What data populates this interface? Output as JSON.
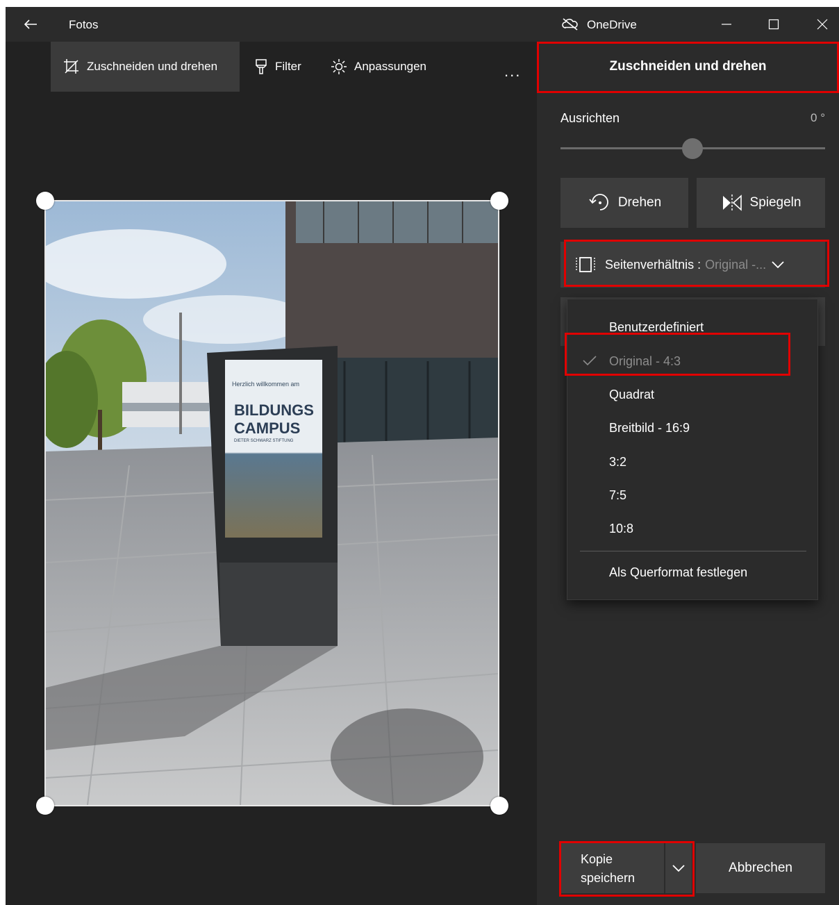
{
  "app": {
    "title": "Fotos",
    "onedrive_label": "OneDrive"
  },
  "toolbar": {
    "crop_label": "Zuschneiden und drehen",
    "filter_label": "Filter",
    "adjust_label": "Anpassungen",
    "more_label": "..."
  },
  "photo": {
    "sign_line1": "Herzlich willkommen am",
    "sign_line2": "BILDUNGS",
    "sign_line3": "CAMPUS",
    "sign_line4": "DIETER SCHWARZ STIFTUNG"
  },
  "panel": {
    "title": "Zuschneiden und drehen",
    "straighten_label": "Ausrichten",
    "straighten_value": "0 °",
    "rotate_label": "Drehen",
    "mirror_label": "Spiegeln",
    "aspect_label": "Seitenverhältnis :",
    "aspect_value": "Original -..."
  },
  "aspect_menu": {
    "items": [
      {
        "label": "Benutzerdefiniert",
        "selected": false
      },
      {
        "label": "Original - 4:3",
        "selected": true
      },
      {
        "label": "Quadrat",
        "selected": false
      },
      {
        "label": "Breitbild - 16:9",
        "selected": false
      },
      {
        "label": "3:2",
        "selected": false
      },
      {
        "label": "7:5",
        "selected": false
      },
      {
        "label": "10:8",
        "selected": false
      }
    ],
    "landscape_label": "Als Querformat festlegen"
  },
  "footer": {
    "save_copy_line1": "Kopie",
    "save_copy_line2": "speichern",
    "cancel_label": "Abbrechen"
  },
  "colors": {
    "highlight": "#e00000",
    "panel_bg": "#2b2b2b",
    "button_bg": "#3d3d3d"
  }
}
